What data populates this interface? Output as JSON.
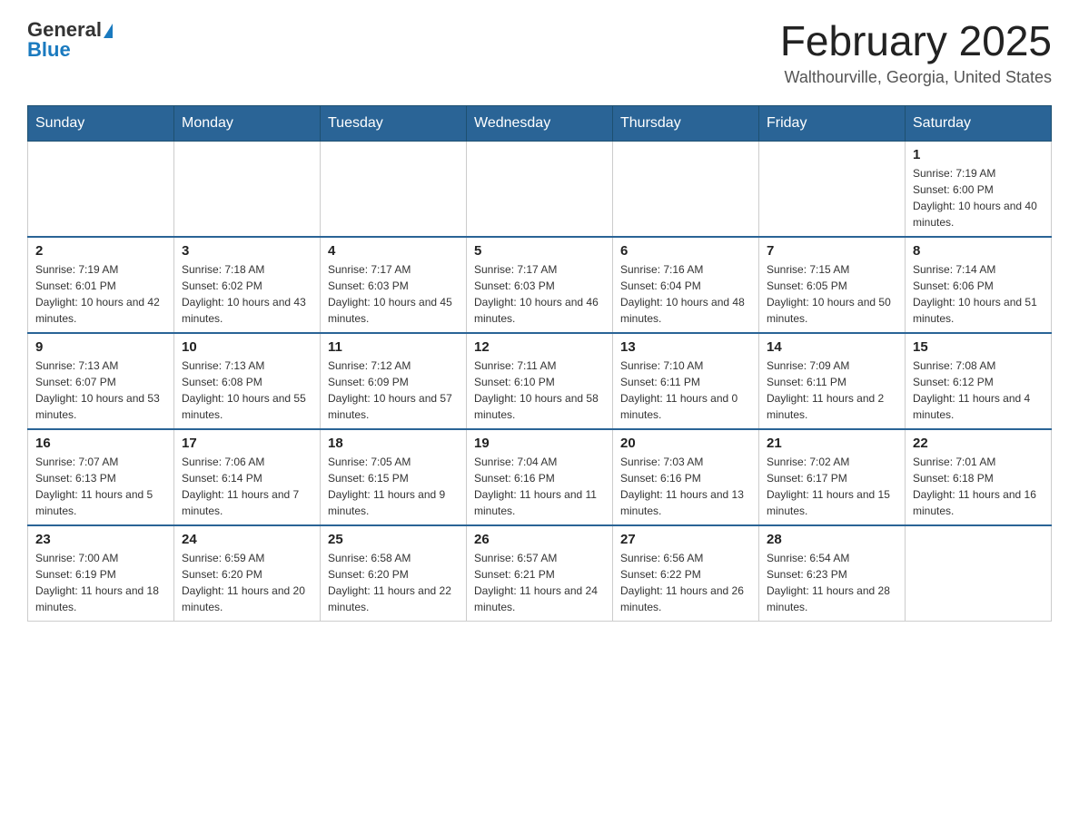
{
  "header": {
    "logo_general": "General",
    "logo_blue": "Blue",
    "title": "February 2025",
    "location": "Walthourville, Georgia, United States"
  },
  "calendar": {
    "days_of_week": [
      "Sunday",
      "Monday",
      "Tuesday",
      "Wednesday",
      "Thursday",
      "Friday",
      "Saturday"
    ],
    "weeks": [
      [
        {
          "day": "",
          "info": ""
        },
        {
          "day": "",
          "info": ""
        },
        {
          "day": "",
          "info": ""
        },
        {
          "day": "",
          "info": ""
        },
        {
          "day": "",
          "info": ""
        },
        {
          "day": "",
          "info": ""
        },
        {
          "day": "1",
          "info": "Sunrise: 7:19 AM\nSunset: 6:00 PM\nDaylight: 10 hours and 40 minutes."
        }
      ],
      [
        {
          "day": "2",
          "info": "Sunrise: 7:19 AM\nSunset: 6:01 PM\nDaylight: 10 hours and 42 minutes."
        },
        {
          "day": "3",
          "info": "Sunrise: 7:18 AM\nSunset: 6:02 PM\nDaylight: 10 hours and 43 minutes."
        },
        {
          "day": "4",
          "info": "Sunrise: 7:17 AM\nSunset: 6:03 PM\nDaylight: 10 hours and 45 minutes."
        },
        {
          "day": "5",
          "info": "Sunrise: 7:17 AM\nSunset: 6:03 PM\nDaylight: 10 hours and 46 minutes."
        },
        {
          "day": "6",
          "info": "Sunrise: 7:16 AM\nSunset: 6:04 PM\nDaylight: 10 hours and 48 minutes."
        },
        {
          "day": "7",
          "info": "Sunrise: 7:15 AM\nSunset: 6:05 PM\nDaylight: 10 hours and 50 minutes."
        },
        {
          "day": "8",
          "info": "Sunrise: 7:14 AM\nSunset: 6:06 PM\nDaylight: 10 hours and 51 minutes."
        }
      ],
      [
        {
          "day": "9",
          "info": "Sunrise: 7:13 AM\nSunset: 6:07 PM\nDaylight: 10 hours and 53 minutes."
        },
        {
          "day": "10",
          "info": "Sunrise: 7:13 AM\nSunset: 6:08 PM\nDaylight: 10 hours and 55 minutes."
        },
        {
          "day": "11",
          "info": "Sunrise: 7:12 AM\nSunset: 6:09 PM\nDaylight: 10 hours and 57 minutes."
        },
        {
          "day": "12",
          "info": "Sunrise: 7:11 AM\nSunset: 6:10 PM\nDaylight: 10 hours and 58 minutes."
        },
        {
          "day": "13",
          "info": "Sunrise: 7:10 AM\nSunset: 6:11 PM\nDaylight: 11 hours and 0 minutes."
        },
        {
          "day": "14",
          "info": "Sunrise: 7:09 AM\nSunset: 6:11 PM\nDaylight: 11 hours and 2 minutes."
        },
        {
          "day": "15",
          "info": "Sunrise: 7:08 AM\nSunset: 6:12 PM\nDaylight: 11 hours and 4 minutes."
        }
      ],
      [
        {
          "day": "16",
          "info": "Sunrise: 7:07 AM\nSunset: 6:13 PM\nDaylight: 11 hours and 5 minutes."
        },
        {
          "day": "17",
          "info": "Sunrise: 7:06 AM\nSunset: 6:14 PM\nDaylight: 11 hours and 7 minutes."
        },
        {
          "day": "18",
          "info": "Sunrise: 7:05 AM\nSunset: 6:15 PM\nDaylight: 11 hours and 9 minutes."
        },
        {
          "day": "19",
          "info": "Sunrise: 7:04 AM\nSunset: 6:16 PM\nDaylight: 11 hours and 11 minutes."
        },
        {
          "day": "20",
          "info": "Sunrise: 7:03 AM\nSunset: 6:16 PM\nDaylight: 11 hours and 13 minutes."
        },
        {
          "day": "21",
          "info": "Sunrise: 7:02 AM\nSunset: 6:17 PM\nDaylight: 11 hours and 15 minutes."
        },
        {
          "day": "22",
          "info": "Sunrise: 7:01 AM\nSunset: 6:18 PM\nDaylight: 11 hours and 16 minutes."
        }
      ],
      [
        {
          "day": "23",
          "info": "Sunrise: 7:00 AM\nSunset: 6:19 PM\nDaylight: 11 hours and 18 minutes."
        },
        {
          "day": "24",
          "info": "Sunrise: 6:59 AM\nSunset: 6:20 PM\nDaylight: 11 hours and 20 minutes."
        },
        {
          "day": "25",
          "info": "Sunrise: 6:58 AM\nSunset: 6:20 PM\nDaylight: 11 hours and 22 minutes."
        },
        {
          "day": "26",
          "info": "Sunrise: 6:57 AM\nSunset: 6:21 PM\nDaylight: 11 hours and 24 minutes."
        },
        {
          "day": "27",
          "info": "Sunrise: 6:56 AM\nSunset: 6:22 PM\nDaylight: 11 hours and 26 minutes."
        },
        {
          "day": "28",
          "info": "Sunrise: 6:54 AM\nSunset: 6:23 PM\nDaylight: 11 hours and 28 minutes."
        },
        {
          "day": "",
          "info": ""
        }
      ]
    ]
  }
}
